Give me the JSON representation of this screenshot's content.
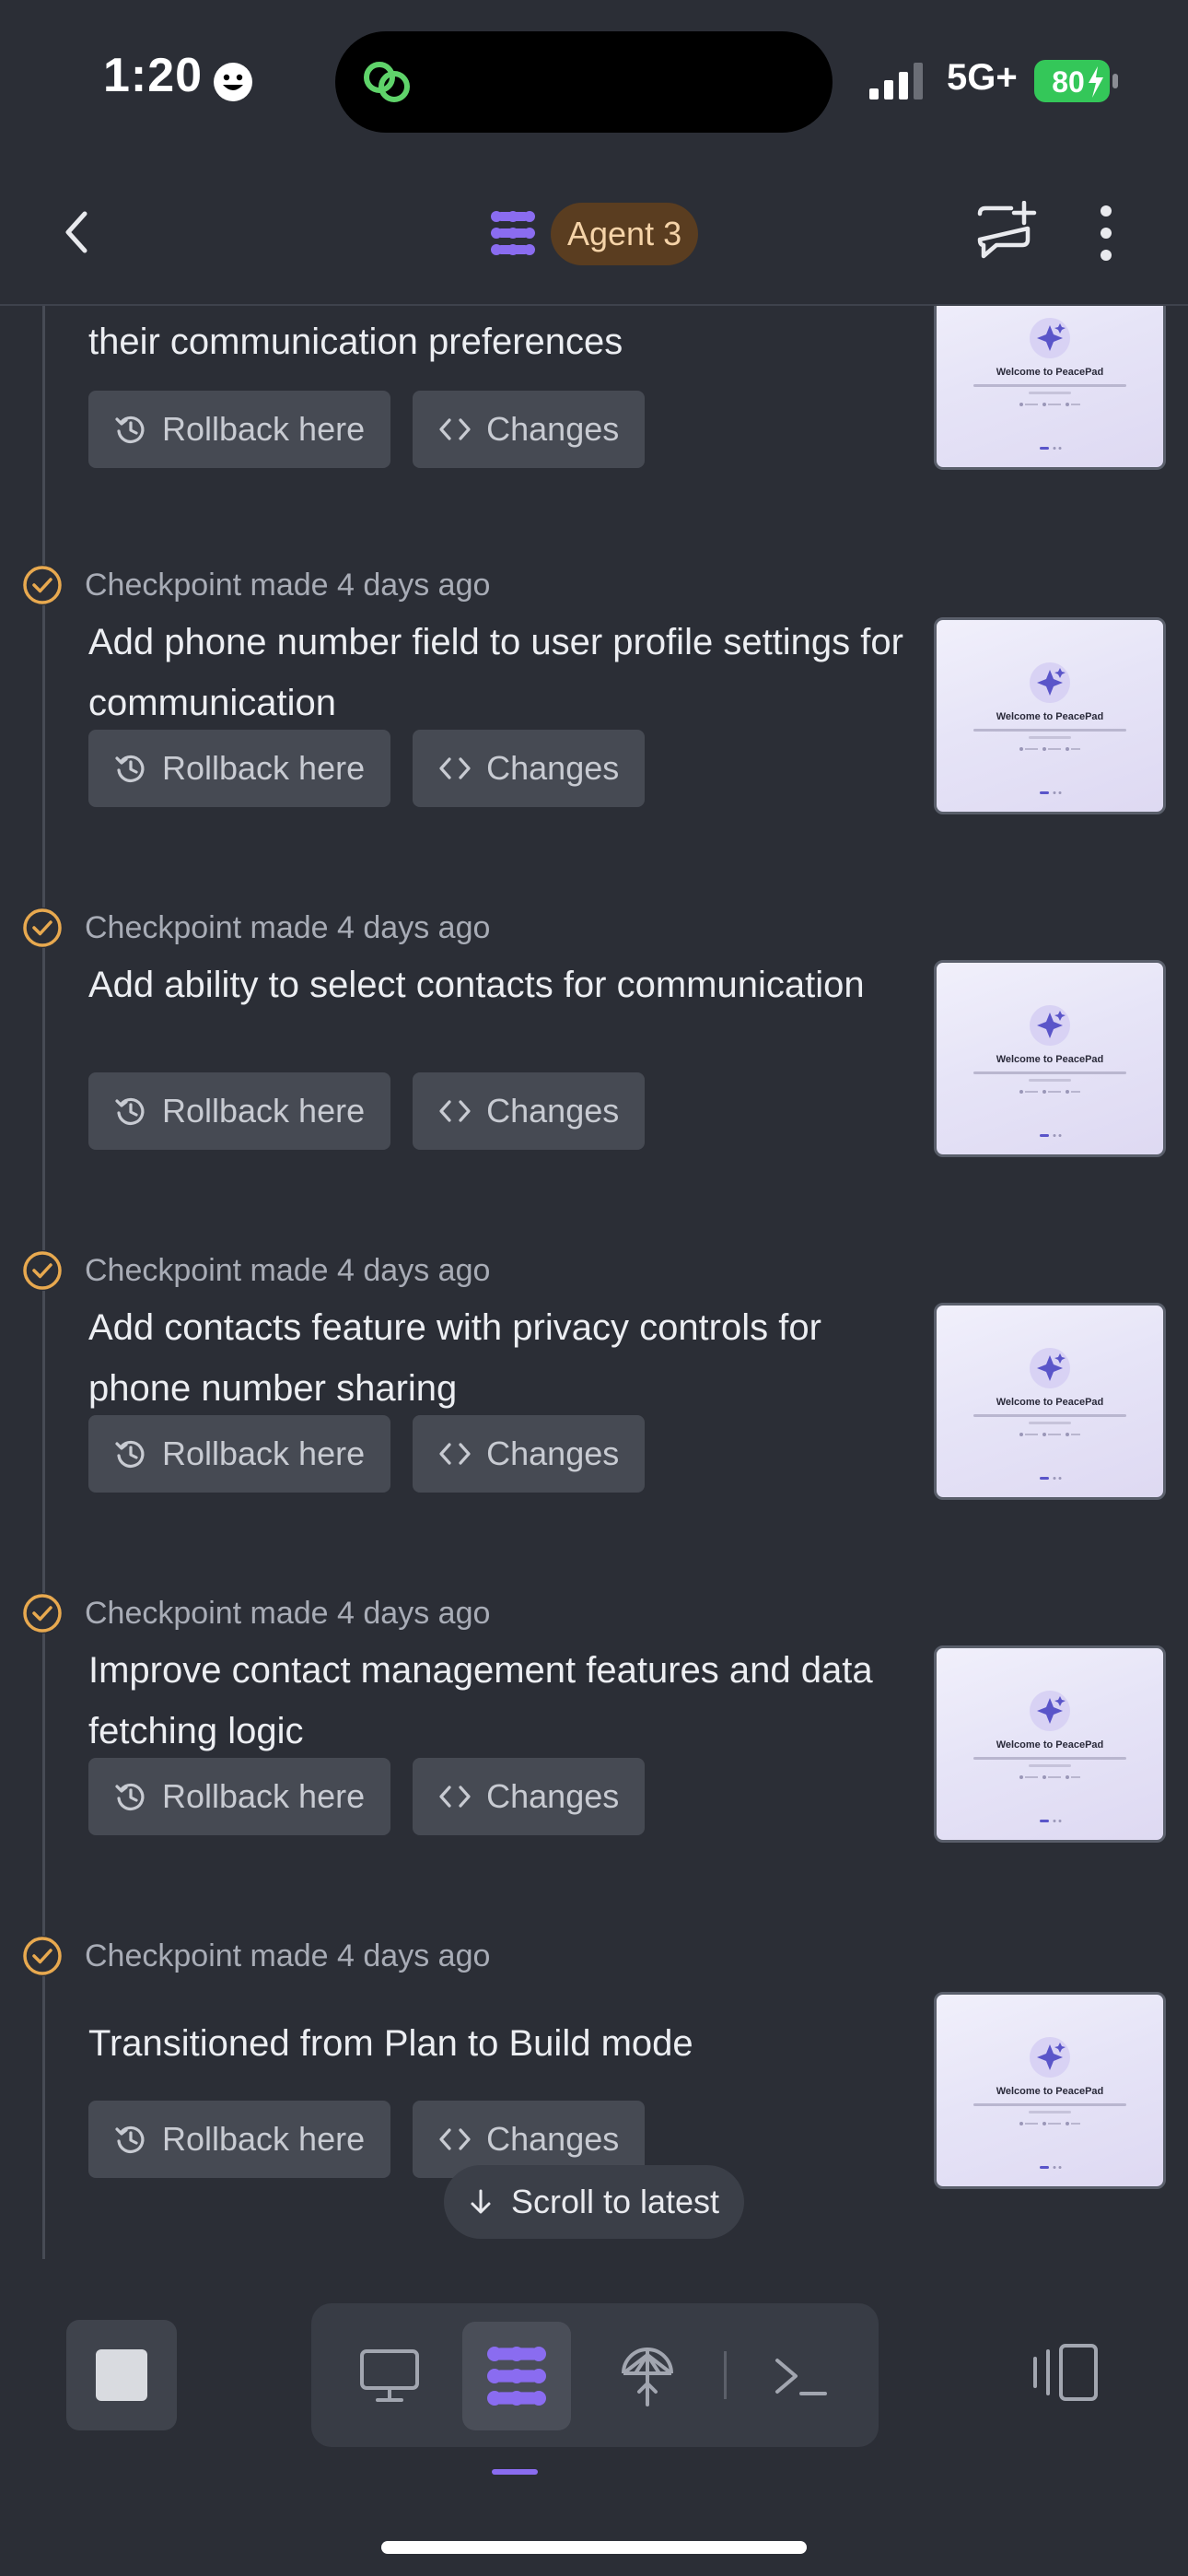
{
  "status_bar": {
    "time": "1:20",
    "network": "5G+",
    "battery": "80"
  },
  "header": {
    "agent_label": "Agent 3"
  },
  "checkpoints": [
    {
      "header": "",
      "description": "Add functionality to manage user contacts and their communication preferences",
      "rollback_label": "Rollback here",
      "changes_label": "Changes",
      "thumbnail": {
        "title": "Welcome to PeacePad"
      }
    },
    {
      "header": "Checkpoint made 4 days ago",
      "description": "Add phone number field to user profile settings for communication",
      "rollback_label": "Rollback here",
      "changes_label": "Changes",
      "thumbnail": {
        "title": "Welcome to PeacePad"
      }
    },
    {
      "header": "Checkpoint made 4 days ago",
      "description": "Add ability to select contacts for communication",
      "rollback_label": "Rollback here",
      "changes_label": "Changes",
      "thumbnail": {
        "title": "Welcome to PeacePad"
      }
    },
    {
      "header": "Checkpoint made 4 days ago",
      "description": "Add contacts feature with privacy controls for phone number sharing",
      "rollback_label": "Rollback here",
      "changes_label": "Changes",
      "thumbnail": {
        "title": "Welcome to PeacePad"
      }
    },
    {
      "header": "Checkpoint made 4 days ago",
      "description": "Improve contact management features and data fetching logic",
      "rollback_label": "Rollback here",
      "changes_label": "Changes",
      "thumbnail": {
        "title": "Welcome to PeacePad"
      }
    },
    {
      "header": "Checkpoint made 4 days ago",
      "description": "Transitioned from Plan to Build mode",
      "rollback_label": "Rollback here",
      "changes_label": "Changes",
      "thumbnail": {
        "title": "Welcome to PeacePad"
      }
    }
  ],
  "scroll_to_latest": "Scroll to latest",
  "colors": {
    "background": "#2b2e36",
    "checkpoint_accent": "#e8a94f",
    "agent_accent": "#8a6cf0",
    "agent_pill_bg": "#5a3d20",
    "battery_green": "#34c759"
  },
  "icons": [
    "back-icon",
    "agent-logo-icon",
    "new-chat-icon",
    "more-icon",
    "checkpoint-check-icon",
    "rollback-icon",
    "code-icon",
    "arrow-down-icon",
    "stop-icon",
    "preview-monitor-icon",
    "agent-icon",
    "deploy-icon",
    "console-icon",
    "panel-toggle-icon"
  ]
}
